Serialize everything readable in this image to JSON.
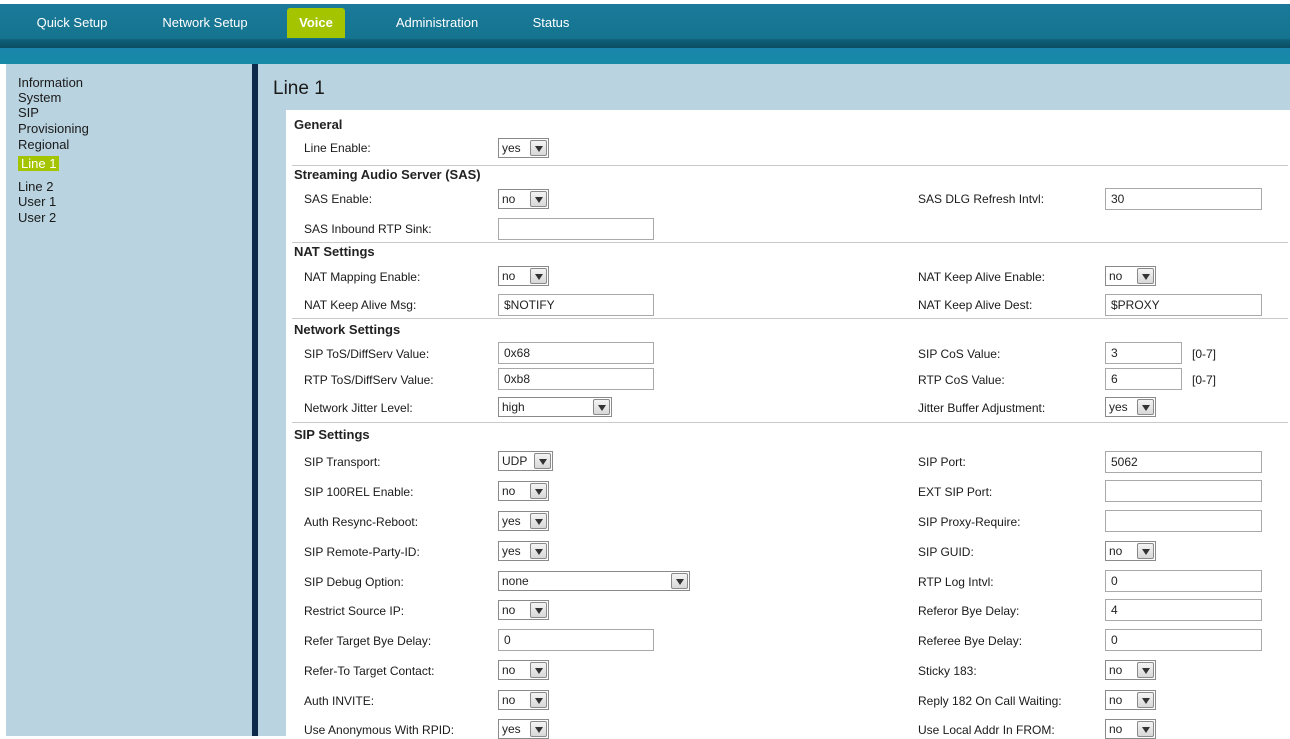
{
  "nav": {
    "tabs": [
      {
        "label": "Quick Setup"
      },
      {
        "label": "Network Setup"
      },
      {
        "label": "Voice"
      },
      {
        "label": "Administration"
      },
      {
        "label": "Status"
      }
    ],
    "active_tab": "Voice",
    "accent_color": "#a4c400",
    "bar_color": "#15748f"
  },
  "sidebar": {
    "items": [
      {
        "label": "Information"
      },
      {
        "label": "System"
      },
      {
        "label": "SIP"
      },
      {
        "label": "Provisioning"
      },
      {
        "label": "Regional"
      },
      {
        "label": "Line 1"
      },
      {
        "label": "Line 2"
      },
      {
        "label": "User 1"
      },
      {
        "label": "User 2"
      }
    ],
    "active_item": "Line 1"
  },
  "page": {
    "title": "Line 1"
  },
  "sections": {
    "general": {
      "title": "General",
      "line_enable": {
        "label": "Line Enable:",
        "value": "yes"
      }
    },
    "sas": {
      "title": "Streaming Audio Server (SAS)",
      "sas_enable": {
        "label": "SAS Enable:",
        "value": "no"
      },
      "sas_dlg_refresh": {
        "label": "SAS DLG Refresh Intvl:",
        "value": "30"
      },
      "sas_inbound_rtp_sink": {
        "label": "SAS Inbound RTP Sink:",
        "value": ""
      }
    },
    "nat": {
      "title": "NAT Settings",
      "nat_mapping_enable": {
        "label": "NAT Mapping Enable:",
        "value": "no"
      },
      "nat_keep_alive_enable": {
        "label": "NAT Keep Alive Enable:",
        "value": "no"
      },
      "nat_keep_alive_msg": {
        "label": "NAT Keep Alive Msg:",
        "value": "$NOTIFY"
      },
      "nat_keep_alive_dest": {
        "label": "NAT Keep Alive Dest:",
        "value": "$PROXY"
      }
    },
    "network": {
      "title": "Network Settings",
      "sip_tos": {
        "label": "SIP ToS/DiffServ Value:",
        "value": "0x68"
      },
      "sip_cos": {
        "label": "SIP CoS Value:",
        "value": "3",
        "hint": "[0-7]"
      },
      "rtp_tos": {
        "label": "RTP ToS/DiffServ Value:",
        "value": "0xb8"
      },
      "rtp_cos": {
        "label": "RTP CoS Value:",
        "value": "6",
        "hint": "[0-7]"
      },
      "jitter_level": {
        "label": "Network Jitter Level:",
        "value": "high"
      },
      "jitter_adjust": {
        "label": "Jitter Buffer Adjustment:",
        "value": "yes"
      }
    },
    "sip": {
      "title": "SIP Settings",
      "sip_transport": {
        "label": "SIP Transport:",
        "value": "UDP"
      },
      "sip_port": {
        "label": "SIP Port:",
        "value": "5062"
      },
      "sip_100rel": {
        "label": "SIP 100REL Enable:",
        "value": "no"
      },
      "ext_sip_port": {
        "label": "EXT SIP Port:",
        "value": ""
      },
      "auth_resync": {
        "label": "Auth Resync-Reboot:",
        "value": "yes"
      },
      "sip_proxy_require": {
        "label": "SIP Proxy-Require:",
        "value": ""
      },
      "remote_party_id": {
        "label": "SIP Remote-Party-ID:",
        "value": "yes"
      },
      "sip_guid": {
        "label": "SIP GUID:",
        "value": "no"
      },
      "debug_option": {
        "label": "SIP Debug Option:",
        "value": "none"
      },
      "rtp_log_intvl": {
        "label": "RTP Log Intvl:",
        "value": "0"
      },
      "restrict_source_ip": {
        "label": "Restrict Source IP:",
        "value": "no"
      },
      "referor_bye_delay": {
        "label": "Referor Bye Delay:",
        "value": "4"
      },
      "refer_target_bye_delay": {
        "label": "Refer Target Bye Delay:",
        "value": "0"
      },
      "referee_bye_delay": {
        "label": "Referee Bye Delay:",
        "value": "0"
      },
      "refer_to_target_contact": {
        "label": "Refer-To Target Contact:",
        "value": "no"
      },
      "sticky_183": {
        "label": "Sticky 183:",
        "value": "no"
      },
      "auth_invite": {
        "label": "Auth INVITE:",
        "value": "no"
      },
      "reply_182": {
        "label": "Reply 182 On Call Waiting:",
        "value": "no"
      },
      "use_anon_rpid": {
        "label": "Use Anonymous With RPID:",
        "value": "yes"
      },
      "use_local_addr": {
        "label": "Use Local Addr In FROM:",
        "value": "no"
      }
    }
  }
}
